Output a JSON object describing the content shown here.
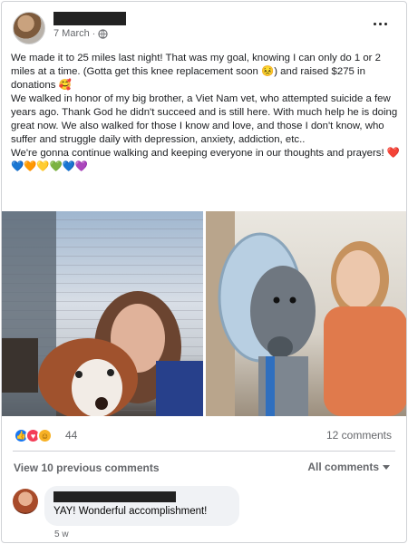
{
  "post": {
    "timestamp": "7 March",
    "privacy_icon": "globe-icon",
    "text": {
      "p1": "We made it to 25 miles last night!  That was my goal, knowing I can only do 1 or 2 miles at a time. (Gotta get this knee replacement soon 😣)  and raised $275 in donations 🥰",
      "p2": " We walked in honor of my big brother, a Viet Nam vet, who attempted suicide a few years ago. Thank God he didn't succeed and is still here. With much help he is doing great now.  We also walked for those I know and love, and those I don't know, who suffer and struggle daily with depression, anxiety,  addiction, etc..",
      "p3": "We're gonna continue walking and keeping everyone in our thoughts and prayers! ❤️💙🧡💛💚💙💜"
    },
    "photos": [
      {
        "icon": "photo-selfie-with-dog-icon"
      },
      {
        "icon": "photo-woman-hugging-dog-icon"
      }
    ]
  },
  "reactions": {
    "icons": [
      "like-icon",
      "love-icon",
      "care-icon"
    ],
    "count": "44",
    "comments_label": "12 comments"
  },
  "comments": {
    "view_previous": "View 10 previous comments",
    "sort_label": "All comments",
    "items": [
      {
        "text": "YAY! Wonderful accomplishment!",
        "time": "5 w"
      }
    ]
  },
  "colors": {
    "like": "#1877f2",
    "love": "#f33e58",
    "care": "#f7b125",
    "secondary_text": "#65676b",
    "bubble_bg": "#f0f2f5"
  }
}
